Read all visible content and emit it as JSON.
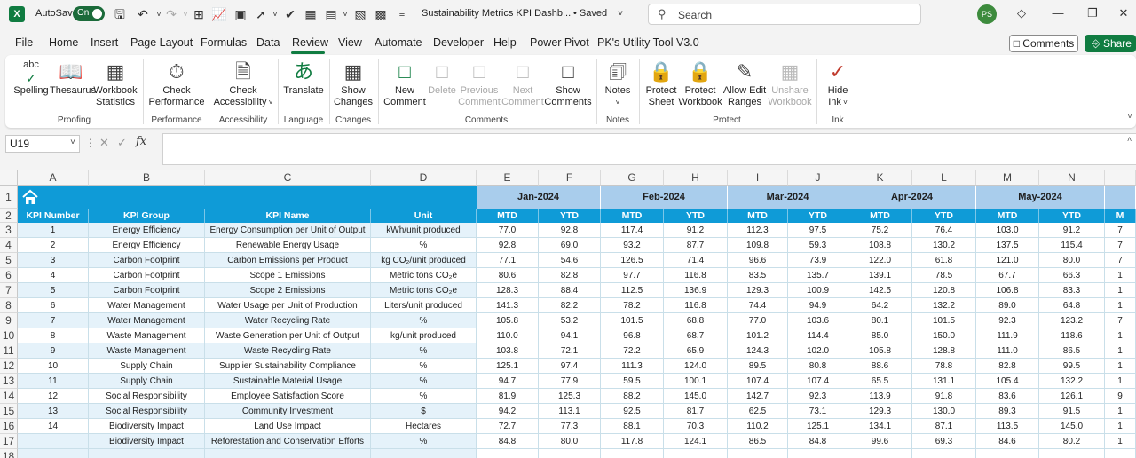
{
  "titlebar": {
    "app_logo": "X",
    "autosave_label": "AutoSave",
    "autosave_state": "On",
    "document_title": "Sustainability Metrics KPI Dashb...",
    "saved_status": "• Saved",
    "search_placeholder": "Search",
    "user_initials": "PS"
  },
  "menu": [
    "File",
    "Home",
    "Insert",
    "Page Layout",
    "Formulas",
    "Data",
    "Review",
    "View",
    "Automate",
    "Developer",
    "Help",
    "Power Pivot",
    "PK's Utility Tool V3.0"
  ],
  "active_tab": "Review",
  "header_buttons": {
    "comments": "Comments",
    "share": "Share"
  },
  "ribbon": {
    "spelling": "Spelling",
    "thesaurus": "Thesaurus",
    "workbook_statistics_1": "Workbook",
    "workbook_statistics_2": "Statistics",
    "group_proofing": "Proofing",
    "check_performance_1": "Check",
    "check_performance_2": "Performance",
    "group_performance": "Performance",
    "check_accessibility_1": "Check",
    "check_accessibility_2": "Accessibility",
    "group_accessibility": "Accessibility",
    "translate": "Translate",
    "group_language": "Language",
    "show_changes_1": "Show",
    "show_changes_2": "Changes",
    "group_changes": "Changes",
    "new_comment_1": "New",
    "new_comment_2": "Comment",
    "delete": "Delete",
    "previous_comment_1": "Previous",
    "previous_comment_2": "Comment",
    "next_comment_1": "Next",
    "next_comment_2": "Comment",
    "show_comments_1": "Show",
    "show_comments_2": "Comments",
    "group_comments": "Comments",
    "notes": "Notes",
    "group_notes": "Notes",
    "protect_sheet_1": "Protect",
    "protect_sheet_2": "Sheet",
    "protect_workbook_1": "Protect",
    "protect_workbook_2": "Workbook",
    "allow_edit_ranges_1": "Allow Edit",
    "allow_edit_ranges_2": "Ranges",
    "unshare_workbook_1": "Unshare",
    "unshare_workbook_2": "Workbook",
    "group_protect": "Protect",
    "hide_ink_1": "Hide",
    "hide_ink_2": "Ink",
    "group_ink": "Ink"
  },
  "formula_bar": {
    "name_box": "U19",
    "fx": "fx",
    "formula": ""
  },
  "columns": [
    "A",
    "B",
    "C",
    "D",
    "E",
    "F",
    "G",
    "H",
    "I",
    "J",
    "K",
    "L",
    "M",
    "N"
  ],
  "months": [
    "Jan-2024",
    "Feb-2024",
    "Mar-2024",
    "Apr-2024",
    "May-2024"
  ],
  "table_headers": {
    "kpi_number": "KPI Number",
    "kpi_group": "KPI Group",
    "kpi_name": "KPI Name",
    "unit": "Unit",
    "mtd": "MTD",
    "ytd": "YTD",
    "partial": "M"
  },
  "rows": [
    {
      "num": "1",
      "group": "Energy Efficiency",
      "name": "Energy Consumption per Unit of Output",
      "unit": "kWh/unit produced",
      "vals": [
        "77.0",
        "92.8",
        "117.4",
        "91.2",
        "112.3",
        "97.5",
        "75.2",
        "76.4",
        "103.0",
        "91.2"
      ],
      "next": "7"
    },
    {
      "num": "2",
      "group": "Energy Efficiency",
      "name": "Renewable Energy Usage",
      "unit": "%",
      "vals": [
        "92.8",
        "69.0",
        "93.2",
        "87.7",
        "109.8",
        "59.3",
        "108.8",
        "130.2",
        "137.5",
        "115.4"
      ],
      "next": "7"
    },
    {
      "num": "3",
      "group": "Carbon Footprint",
      "name": "Carbon Emissions per Product",
      "unit": "kg CO₂/unit produced",
      "vals": [
        "77.1",
        "54.6",
        "126.5",
        "71.4",
        "96.6",
        "73.9",
        "122.0",
        "61.8",
        "121.0",
        "80.0"
      ],
      "next": "7"
    },
    {
      "num": "4",
      "group": "Carbon Footprint",
      "name": "Scope 1 Emissions",
      "unit": "Metric tons CO₂e",
      "vals": [
        "80.6",
        "82.8",
        "97.7",
        "116.8",
        "83.5",
        "135.7",
        "139.1",
        "78.5",
        "67.7",
        "66.3"
      ],
      "next": "1"
    },
    {
      "num": "5",
      "group": "Carbon Footprint",
      "name": "Scope 2 Emissions",
      "unit": "Metric tons CO₂e",
      "vals": [
        "128.3",
        "88.4",
        "112.5",
        "136.9",
        "129.3",
        "100.9",
        "142.5",
        "120.8",
        "106.8",
        "83.3"
      ],
      "next": "1"
    },
    {
      "num": "6",
      "group": "Water Management",
      "name": "Water Usage per Unit of Production",
      "unit": "Liters/unit produced",
      "vals": [
        "141.3",
        "82.2",
        "78.2",
        "116.8",
        "74.4",
        "94.9",
        "64.2",
        "132.2",
        "89.0",
        "64.8"
      ],
      "next": "1"
    },
    {
      "num": "7",
      "group": "Water Management",
      "name": "Water Recycling Rate",
      "unit": "%",
      "vals": [
        "105.8",
        "53.2",
        "101.5",
        "68.8",
        "77.0",
        "103.6",
        "80.1",
        "101.5",
        "92.3",
        "123.2"
      ],
      "next": "7"
    },
    {
      "num": "8",
      "group": "Waste Management",
      "name": "Waste Generation per Unit of Output",
      "unit": "kg/unit produced",
      "vals": [
        "110.0",
        "94.1",
        "96.8",
        "68.7",
        "101.2",
        "114.4",
        "85.0",
        "150.0",
        "111.9",
        "118.6"
      ],
      "next": "1"
    },
    {
      "num": "9",
      "group": "Waste Management",
      "name": "Waste Recycling Rate",
      "unit": "%",
      "vals": [
        "103.8",
        "72.1",
        "72.2",
        "65.9",
        "124.3",
        "102.0",
        "105.8",
        "128.8",
        "111.0",
        "86.5"
      ],
      "next": "1"
    },
    {
      "num": "10",
      "group": "Supply Chain",
      "name": "Supplier Sustainability Compliance",
      "unit": "%",
      "vals": [
        "125.1",
        "97.4",
        "111.3",
        "124.0",
        "89.5",
        "80.8",
        "88.6",
        "78.8",
        "82.8",
        "99.5"
      ],
      "next": "1"
    },
    {
      "num": "11",
      "group": "Supply Chain",
      "name": "Sustainable Material Usage",
      "unit": "%",
      "vals": [
        "94.7",
        "77.9",
        "59.5",
        "100.1",
        "107.4",
        "107.4",
        "65.5",
        "131.1",
        "105.4",
        "132.2"
      ],
      "next": "1"
    },
    {
      "num": "12",
      "group": "Social Responsibility",
      "name": "Employee Satisfaction Score",
      "unit": "%",
      "vals": [
        "81.9",
        "125.3",
        "88.2",
        "145.0",
        "142.7",
        "92.3",
        "113.9",
        "91.8",
        "83.6",
        "126.1"
      ],
      "next": "9"
    },
    {
      "num": "13",
      "group": "Social Responsibility",
      "name": "Community Investment",
      "unit": "$",
      "vals": [
        "94.2",
        "113.1",
        "92.5",
        "81.7",
        "62.5",
        "73.1",
        "129.3",
        "130.0",
        "89.3",
        "91.5"
      ],
      "next": "1"
    },
    {
      "num": "14",
      "group": "Biodiversity Impact",
      "name": "Land Use Impact",
      "unit": "Hectares",
      "vals": [
        "72.7",
        "77.3",
        "88.1",
        "70.3",
        "110.2",
        "125.1",
        "134.1",
        "87.1",
        "113.5",
        "145.0"
      ],
      "next": "1"
    },
    {
      "num": "",
      "group": "Biodiversity Impact",
      "name": "Reforestation and Conservation Efforts",
      "unit": "%",
      "vals": [
        "84.8",
        "80.0",
        "117.8",
        "124.1",
        "86.5",
        "84.8",
        "99.6",
        "69.3",
        "84.6",
        "80.2"
      ],
      "next": "1"
    }
  ],
  "colors": {
    "accent": "#107c41",
    "table_header": "#0f9bd7",
    "month_header": "#a9cdec",
    "row_band": "#e5f2fa"
  }
}
